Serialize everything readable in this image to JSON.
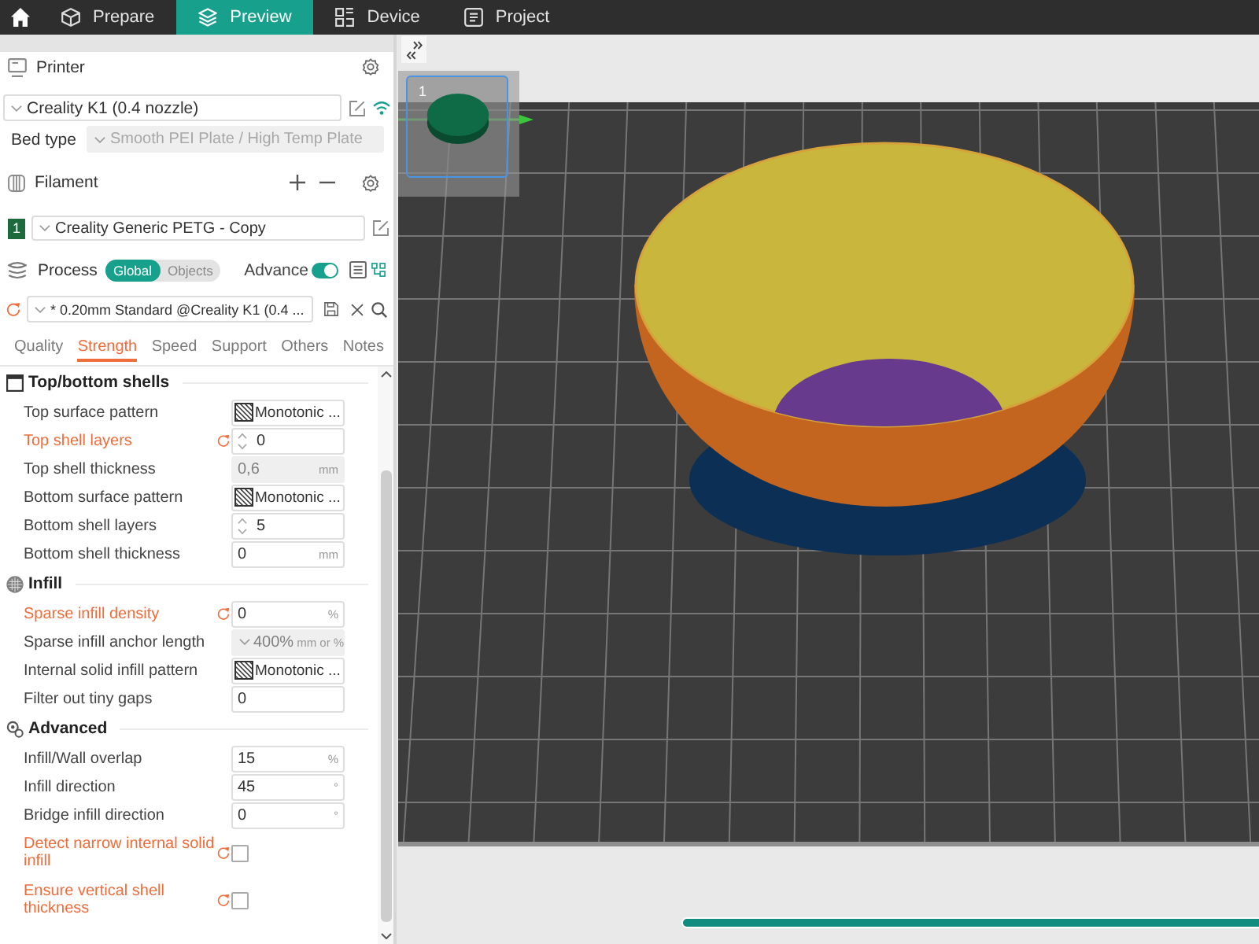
{
  "top_bar": {
    "tabs": [
      {
        "label": "Prepare",
        "selected": false
      },
      {
        "label": "Preview",
        "selected": true
      },
      {
        "label": "Device",
        "selected": false
      },
      {
        "label": "Project",
        "selected": false
      }
    ]
  },
  "sidebar": {
    "printer": {
      "title": "Printer",
      "preset": "Creality K1 (0.4 nozzle)",
      "bed_type": {
        "label": "Bed type",
        "value": "Smooth PEI Plate / High Temp Plate",
        "disabled": true
      }
    },
    "filament": {
      "title": "Filament",
      "slots": [
        {
          "number": "1",
          "color": "#1d6b3c",
          "preset": "Creality Generic PETG - Copy"
        }
      ]
    },
    "process": {
      "title": "Process",
      "scope": [
        {
          "label": "Global",
          "selected": true
        },
        {
          "label": "Objects",
          "selected": false
        }
      ],
      "advance": {
        "label": "Advance",
        "on": true
      },
      "preset": {
        "value": "* 0.20mm Standard @Creality K1 (0.4 ...",
        "modified": true
      }
    },
    "settings_tabs": [
      {
        "label": "Quality",
        "selected": false
      },
      {
        "label": "Strength",
        "selected": true
      },
      {
        "label": "Speed",
        "selected": false
      },
      {
        "label": "Support",
        "selected": false
      },
      {
        "label": "Others",
        "selected": false
      },
      {
        "label": "Notes",
        "selected": false
      }
    ],
    "sections": [
      {
        "title": "Top/bottom shells",
        "rows": [
          {
            "label": "Top surface pattern",
            "kind": "pattern",
            "value": "Monotonic ...",
            "modified": false,
            "disabled": false
          },
          {
            "label": "Top shell layers",
            "kind": "stepper",
            "value": "0",
            "modified": true,
            "disabled": false
          },
          {
            "label": "Top shell thickness",
            "kind": "number",
            "value": "0,6",
            "unit": "mm",
            "modified": false,
            "disabled": true
          },
          {
            "label": "Bottom surface pattern",
            "kind": "pattern",
            "value": "Monotonic ...",
            "modified": false,
            "disabled": false
          },
          {
            "label": "Bottom shell layers",
            "kind": "stepper",
            "value": "5",
            "modified": false,
            "disabled": false
          },
          {
            "label": "Bottom shell thickness",
            "kind": "number",
            "value": "0",
            "unit": "mm",
            "modified": false,
            "disabled": false
          }
        ]
      },
      {
        "title": "Infill",
        "rows": [
          {
            "label": "Sparse infill density",
            "kind": "number",
            "value": "0",
            "unit": "%",
            "modified": true,
            "disabled": false
          },
          {
            "label": "Sparse infill anchor length",
            "kind": "select",
            "value": "400%",
            "unit": "mm or %",
            "modified": false,
            "disabled": true
          },
          {
            "label": "Internal solid infill pattern",
            "kind": "pattern",
            "value": "Monotonic ...",
            "modified": false,
            "disabled": false
          },
          {
            "label": "Filter out tiny gaps",
            "kind": "number",
            "value": "0",
            "modified": false,
            "disabled": false
          }
        ]
      },
      {
        "title": "Advanced",
        "rows": [
          {
            "label": "Infill/Wall overlap",
            "kind": "number",
            "value": "15",
            "unit": "%",
            "modified": false,
            "disabled": false
          },
          {
            "label": "Infill direction",
            "kind": "number",
            "value": "45",
            "unit": "°",
            "modified": false,
            "disabled": false
          },
          {
            "label": "Bridge infill direction",
            "kind": "number",
            "value": "0",
            "unit": "°",
            "modified": false,
            "disabled": false
          },
          {
            "label": "Detect narrow internal solid infill",
            "kind": "checkbox",
            "checked": false,
            "modified": true,
            "disabled": false
          },
          {
            "label": "Ensure vertical shell thickness",
            "kind": "checkbox",
            "checked": false,
            "modified": true,
            "disabled": false
          }
        ]
      }
    ]
  },
  "viewport": {
    "plates": [
      {
        "number": "1",
        "selected": true
      }
    ],
    "move_slider": {
      "level": 1
    }
  }
}
